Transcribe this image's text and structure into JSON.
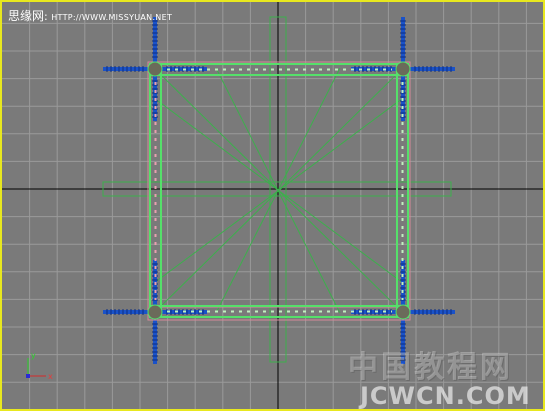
{
  "header": {
    "site_name": "思缘网",
    "separator": ":",
    "site_url": "HTTP://WWW.MISSYUAN.NET"
  },
  "axis_gizmo": {
    "y_label": "y",
    "x_label": "x"
  },
  "watermark": {
    "cn_text": "中国教程网",
    "en_text": "JCWCN.COM"
  },
  "colors": {
    "viewport_border": "#e8e81e",
    "background": "#7a7a7a",
    "grid": "#9a9a9a",
    "home_grid": "#000000",
    "frame_green": "#55e06a",
    "guide_green": "#3cb04c",
    "post_blue": "#1a52c8",
    "selection_pink": "#d68a9a",
    "joint": "#6b6b5a"
  }
}
